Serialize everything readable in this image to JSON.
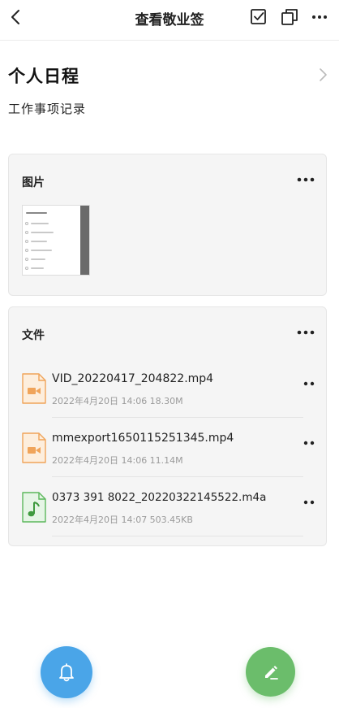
{
  "topbar": {
    "title": "查看敬业签",
    "back_icon": "back-arrow-icon",
    "actions": [
      "checkbox-icon",
      "copy-icon",
      "more-icon"
    ]
  },
  "note": {
    "title": "个人日程",
    "content": "工作事项记录"
  },
  "images_section": {
    "title": "图片",
    "thumbnail_items": [
      "我的分类",
      "最近便签",
      "团队分享便签",
      "重要便签",
      "待提醒便签",
      "个人计划",
      "全部便签"
    ]
  },
  "files_section": {
    "title": "文件",
    "files": [
      {
        "name": "VID_20220417_204822.mp4",
        "meta": "2022年4月20日 14:06 18.30M",
        "type": "video",
        "color": "#f0a45a"
      },
      {
        "name": "mmexport1650115251345.mp4",
        "meta": "2022年4月20日 14:06 11.14M",
        "type": "video",
        "color": "#f0a45a"
      },
      {
        "name": "0373 391 8022_20220322145522.m4a",
        "meta": "2022年4月20日 14:07 503.45KB",
        "type": "audio",
        "color": "#5cb85c"
      }
    ]
  },
  "fabs": {
    "reminder": {
      "icon": "bell-icon",
      "color": "#4aa5e8"
    },
    "edit": {
      "icon": "pencil-icon",
      "color": "#6bbd6b"
    }
  }
}
